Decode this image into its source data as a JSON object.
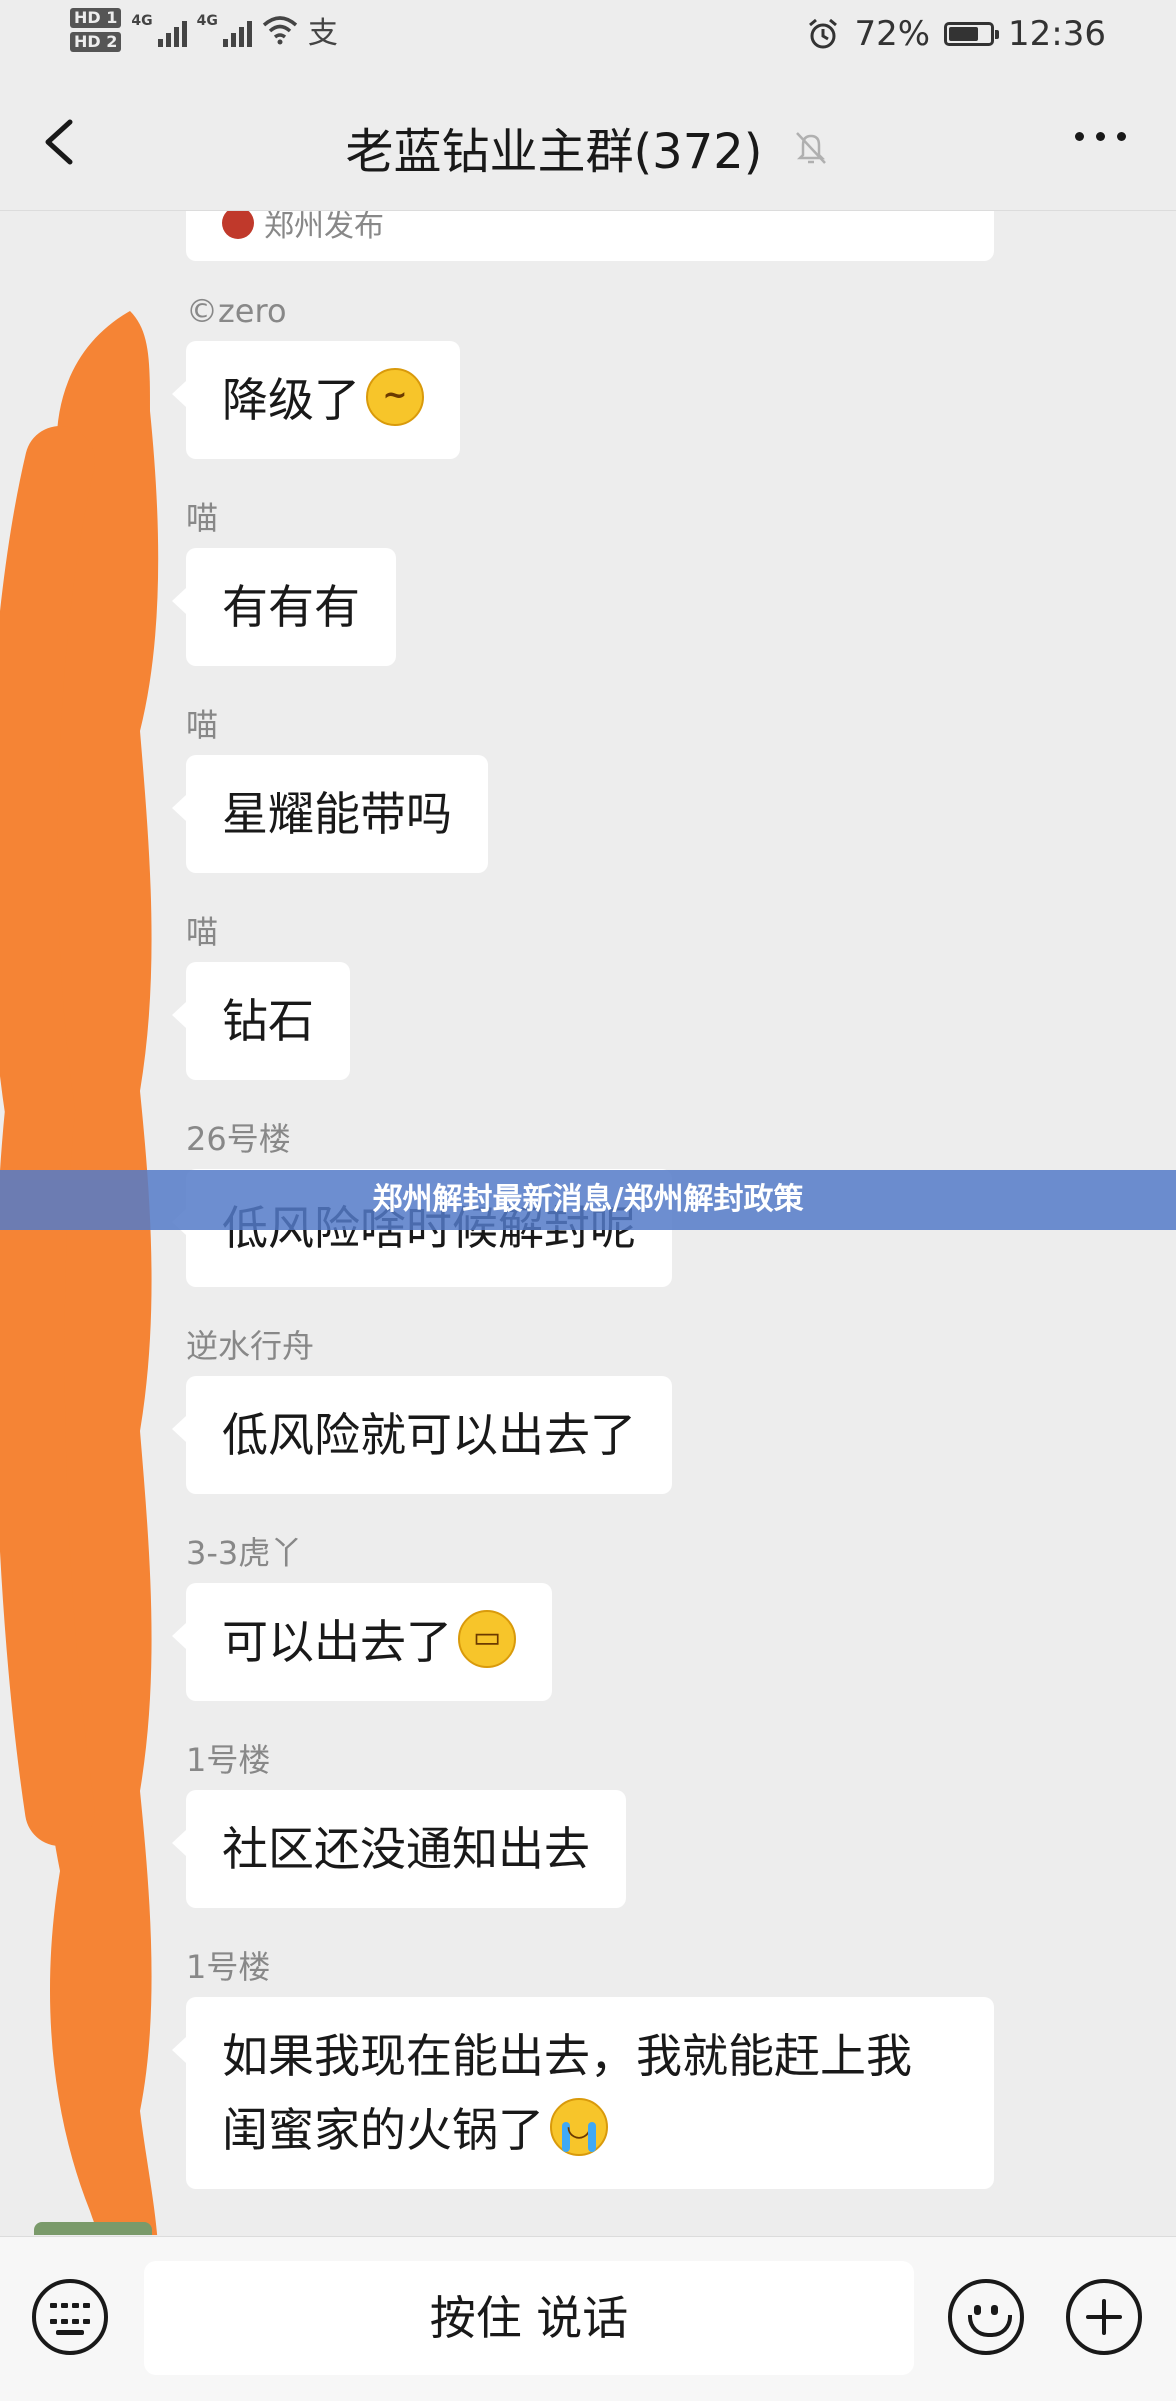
{
  "status_bar": {
    "hd1": "HD 1",
    "hd2": "HD 2",
    "net1": "4G",
    "net2": "4G",
    "battery_percent": "72%",
    "battery_level": 0.72,
    "time": "12:36"
  },
  "nav": {
    "title": "老蓝钻业主群(372)"
  },
  "top_card": {
    "source": "郑州发布"
  },
  "messages": [
    {
      "sender": "©zero",
      "text": "降级了",
      "emoji": "thinking-face"
    },
    {
      "sender": "喵",
      "text": "有有有"
    },
    {
      "sender": "喵",
      "text": "星耀能带吗"
    },
    {
      "sender": "喵",
      "text": "钻石"
    },
    {
      "sender": "26号楼",
      "text": "低风险啥时候解封呢"
    },
    {
      "sender": "逆水行舟",
      "text": "低风险就可以出去了"
    },
    {
      "sender": "3-3虎丫",
      "text": "可以出去了",
      "emoji": "grinning-face"
    },
    {
      "sender": "1号楼",
      "text": "社区还没通知出去"
    },
    {
      "sender": "1号楼",
      "text_line1": "如果我现在能出去，我就能赶上我",
      "text_line2": "闺蜜家的火锅了",
      "emoji": "crying-face"
    }
  ],
  "banner": {
    "text": "郑州解封最新消息/郑州解封政策"
  },
  "input_bar": {
    "voice_label": "按住 说话"
  }
}
